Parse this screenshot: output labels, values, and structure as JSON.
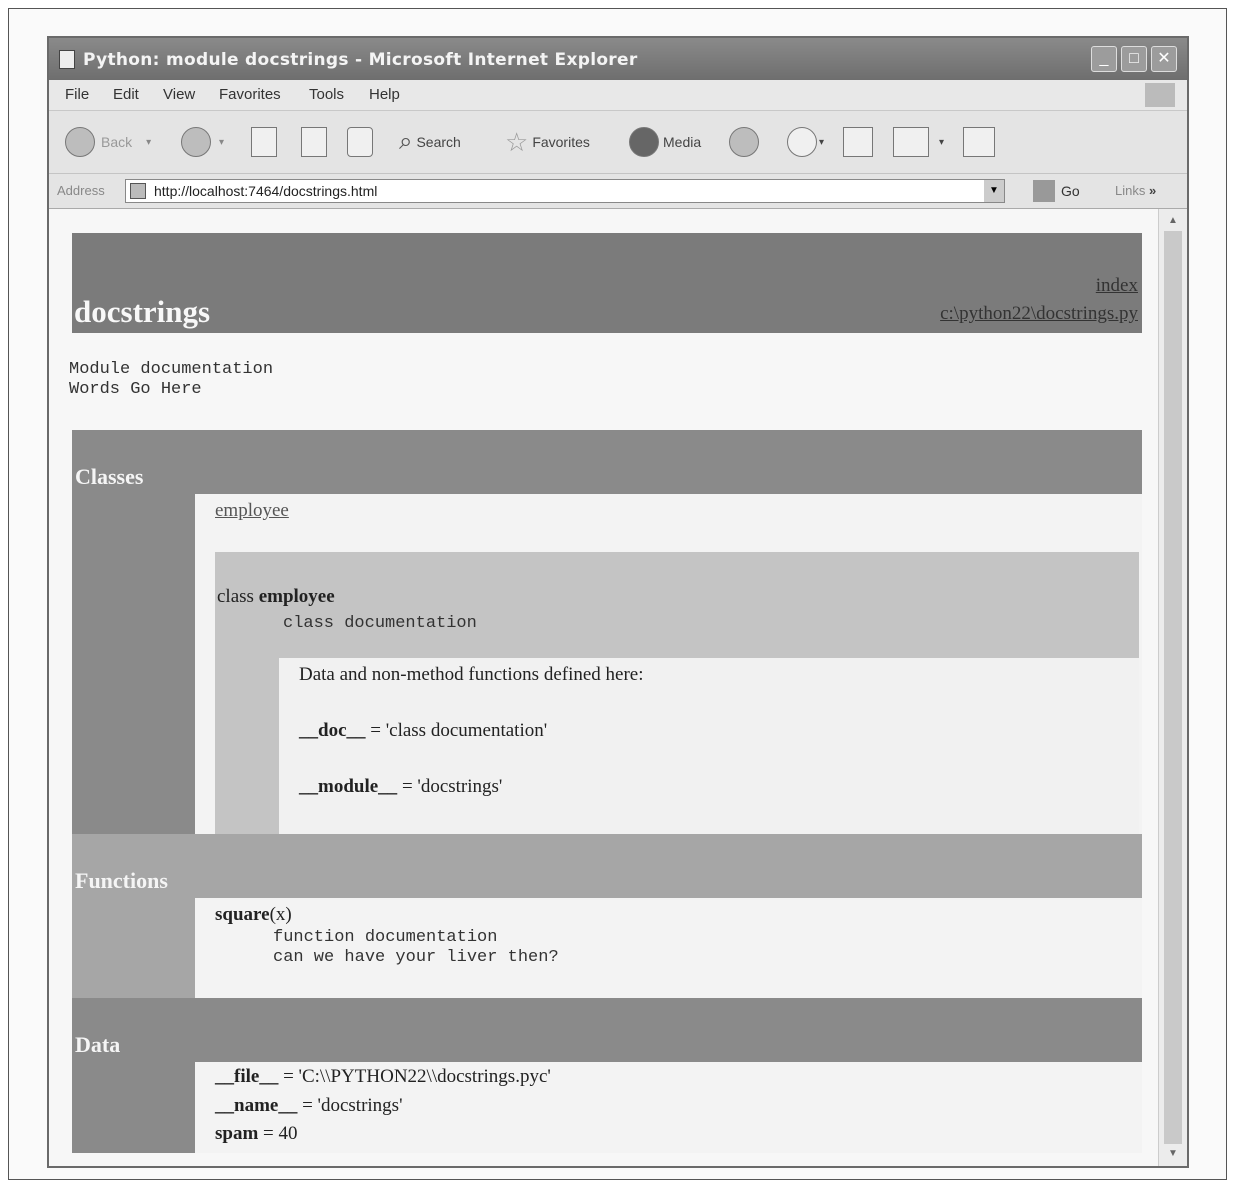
{
  "window": {
    "title": "Python: module docstrings - Microsoft Internet Explorer",
    "buttons": {
      "minimize": "_",
      "maximize": "□",
      "close": "✕"
    }
  },
  "menu": [
    "File",
    "Edit",
    "View",
    "Favorites",
    "Tools",
    "Help"
  ],
  "toolbar": {
    "back": "Back",
    "search": "Search",
    "favorites": "Favorites",
    "media": "Media"
  },
  "address": {
    "label": "Address",
    "url": "http://localhost:7464/docstrings.html",
    "go": "Go",
    "links": "Links",
    "chevron": "»"
  },
  "page": {
    "module_name": "docstrings",
    "index_link": "index",
    "file_link": "c:\\python22\\docstrings.py",
    "module_doc": [
      "Module documentation",
      "Words Go Here"
    ],
    "classes": {
      "heading": "Classes",
      "link": "employee",
      "class_keyword": "class",
      "class_name": "employee",
      "class_doc": "class documentation",
      "data_note": "Data and non-method functions defined here:",
      "attrs": [
        {
          "name": "__doc__",
          "value": " = 'class documentation'"
        },
        {
          "name": "__module__",
          "value": " = 'docstrings'"
        }
      ]
    },
    "functions": {
      "heading": "Functions",
      "signature_name": "square",
      "signature_args": "(x)",
      "doc": [
        "function documentation",
        "can we have your liver then?"
      ]
    },
    "data": {
      "heading": "Data",
      "items": [
        {
          "name": "__file__",
          "value": " = 'C:\\\\PYTHON22\\\\docstrings.pyc'"
        },
        {
          "name": "__name__",
          "value": " = 'docstrings'"
        },
        {
          "name": "spam",
          "value": " = 40"
        }
      ]
    }
  },
  "colors": {
    "title_bar": "#7a7a7a",
    "section_bar": "#8a8a8a",
    "class_bg": "#c4c4c4"
  }
}
